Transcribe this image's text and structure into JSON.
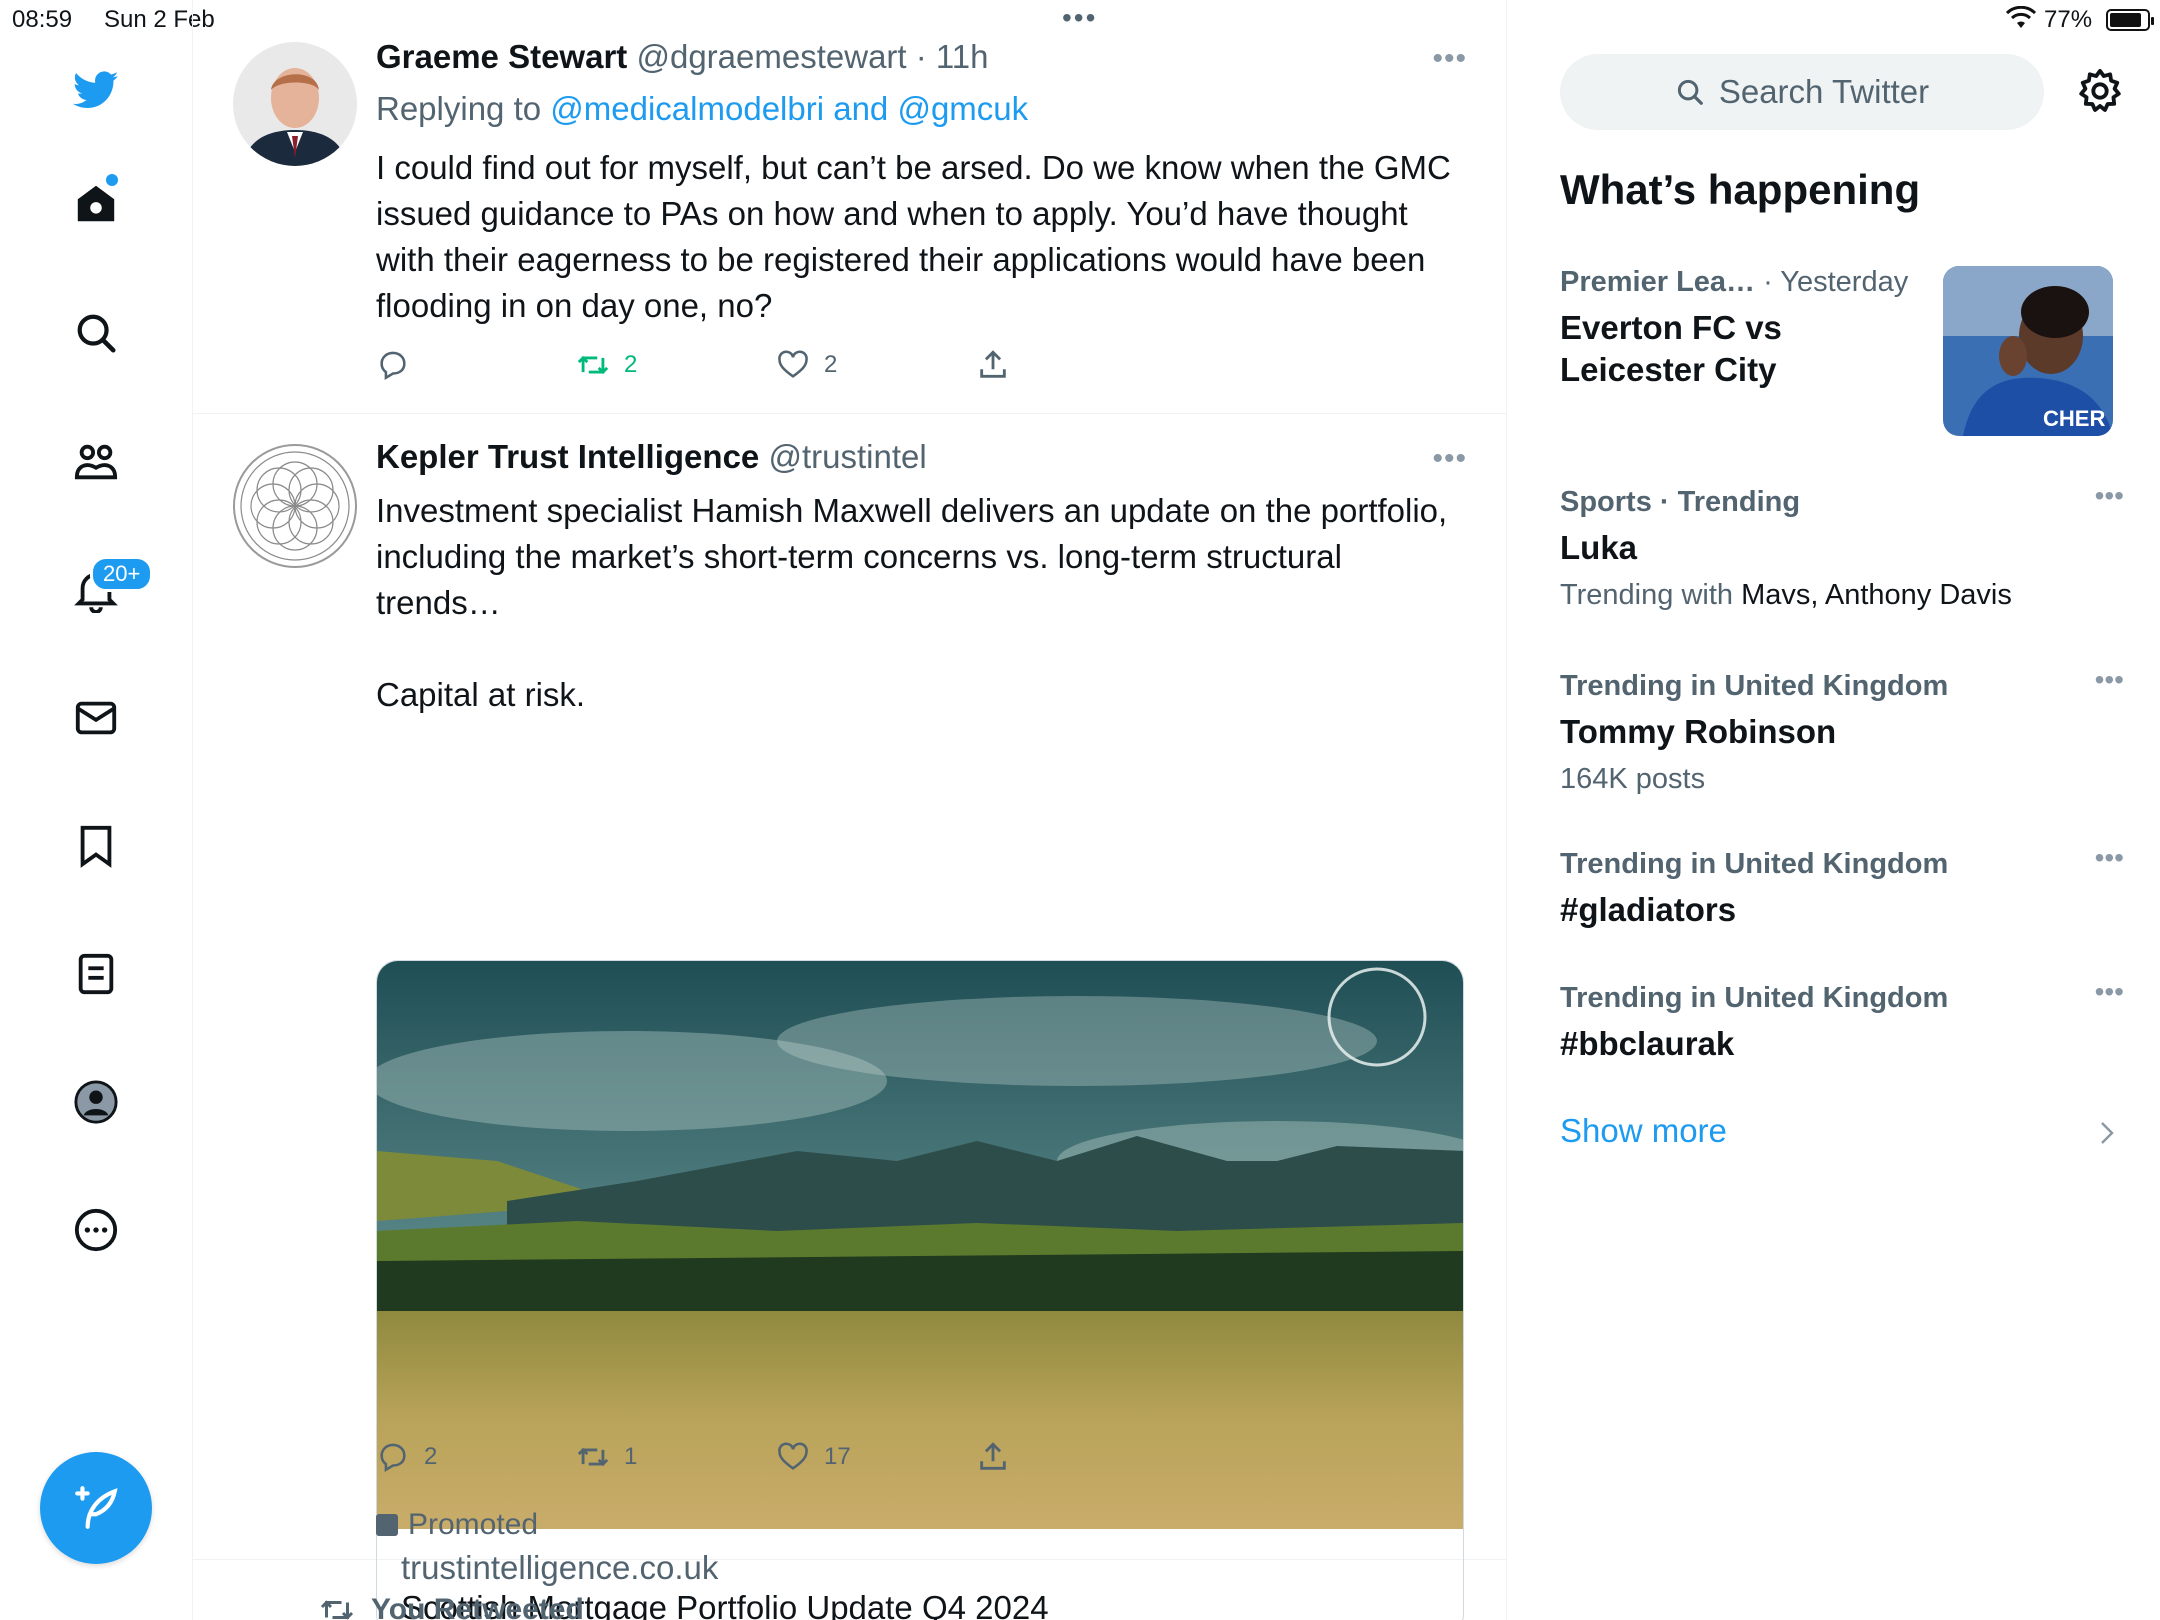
{
  "status_bar": {
    "time": "08:59",
    "date": "Sun 2 Feb",
    "battery": "77%"
  },
  "nav": {
    "notifications_badge": "20+"
  },
  "tweets": [
    {
      "name": "Graeme Stewart",
      "handle": "@dgraemestewart",
      "time": "· 11h",
      "replying_prefix": "Replying to",
      "replying_to": "@medicalmodelbri and @gmcuk",
      "text": "I could find out for myself, but can’t be arsed. Do we know when the GMC issued guidance to PAs on how and when to apply. You’d have thought with their eagerness to be registered their applications would have been flooding in on day one, no?",
      "replies": "",
      "retweets": "2",
      "likes": "2"
    },
    {
      "name": "Kepler Trust Intelligence",
      "handle": "@trustintel",
      "text": "Investment specialist Hamish Maxwell delivers an update on the portfolio, including the market’s short-term concerns vs. long-term structural trends…\n\nCapital at risk.",
      "card_domain": "trustintelligence.co.uk",
      "card_title": "Scottish Mortgage Portfolio Update Q4 2024",
      "replies": "2",
      "retweets": "1",
      "likes": "17",
      "promoted": "Promoted"
    }
  ],
  "retweet_header": "You Retweeted",
  "sidebar": {
    "search_placeholder": "Search Twitter",
    "heading": "What’s happening",
    "trends": [
      {
        "meta": "Premier Lea…",
        "meta2": "· Yesterday",
        "title": "Everton FC vs Leicester City"
      },
      {
        "meta": "Sports · Trending",
        "title": "Luka",
        "sub_prefix": "Trending with",
        "sub": "Mavs, Anthony Davis"
      },
      {
        "meta": "Trending in United Kingdom",
        "title": "Tommy Robinson",
        "sub": "164K posts"
      },
      {
        "meta": "Trending in United Kingdom",
        "title": "#gladiators"
      },
      {
        "meta": "Trending in United Kingdom",
        "title": "#bbclaurak"
      }
    ],
    "show_more": "Show more"
  },
  "colors": {
    "brand": "#1d9bf0",
    "retweet_active": "#00ba7c",
    "secondary_text": "#536471"
  }
}
